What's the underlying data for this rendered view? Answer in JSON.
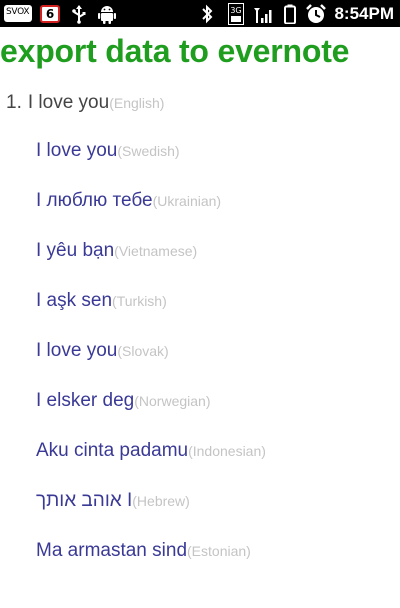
{
  "status_bar": {
    "notification_label": "SVOX",
    "badge_count": "6",
    "icons": [
      "usb-icon",
      "android-icon",
      "bluetooth-icon",
      "3g-icon",
      "signal-icon",
      "battery-icon",
      "alarm-icon"
    ],
    "network_label": "3G",
    "time": "8:54PM"
  },
  "title": "export data to evernote",
  "colors": {
    "title": "#1f9d1f",
    "phrase": "#3a3a96",
    "language": "#c4c4c4"
  },
  "entries": [
    {
      "number": "1.",
      "phrase": "I love you",
      "language": "(English)"
    },
    {
      "phrase": "I love you",
      "language": "(Swedish)"
    },
    {
      "phrase": "I люблю тебе",
      "language": "(Ukrainian)"
    },
    {
      "phrase": "I yêu bạn",
      "language": "(Vietnamese)"
    },
    {
      "phrase": "I aşk sen",
      "language": "(Turkish)"
    },
    {
      "phrase": "I love you",
      "language": "(Slovak)"
    },
    {
      "phrase": "I elsker deg",
      "language": "(Norwegian)"
    },
    {
      "phrase": "Aku cinta padamu",
      "language": "(Indonesian)"
    },
    {
      "phrase": "אוהב אותך I",
      "language": "(Hebrew)"
    },
    {
      "phrase": "Ma armastan sind",
      "language": "(Estonian)"
    }
  ]
}
